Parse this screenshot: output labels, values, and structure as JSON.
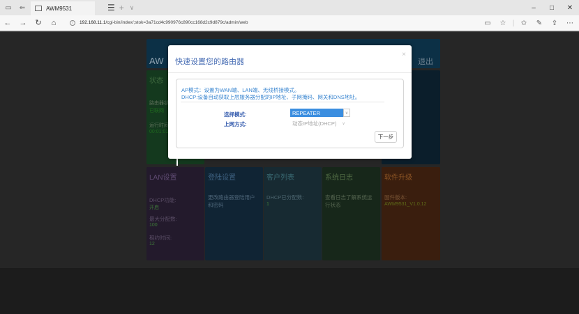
{
  "browser": {
    "tab_title": "AWM9531",
    "url_host": "192.168.11.1",
    "url_path": "/cgi-bin/index/;stok=3a71cd4c990976c890cc168d2c9d879c/admin/web",
    "new_tab": "+",
    "tab_dropdown": "∨"
  },
  "page": {
    "header": {
      "brand": "AW",
      "logout": "退出"
    },
    "status_tile": {
      "title": "状态",
      "router_status_label": "路由器状态",
      "router_status_value": "已联网",
      "uptime_label": "运行时间",
      "uptime_value": "00:01:01"
    },
    "lan_tile": {
      "title": "LAN设置",
      "dhcp_label": "DHCP功能:",
      "dhcp_value": "开启",
      "max_alloc_label": "最大分配数:",
      "max_alloc_value": "100",
      "lease_label": "租约时间:",
      "lease_value": "12"
    },
    "login_tile": {
      "title": "登陆设置",
      "text": "更改路由器登陆用户和密码"
    },
    "clients_tile": {
      "title": "客户列表",
      "text": "DHCP已分配数:",
      "value": "1"
    },
    "log_tile": {
      "title": "系统日志",
      "text": "查看日志了解系统运行状态"
    },
    "fw_tile": {
      "title": "软件升级",
      "text": "固件版本:",
      "value": "AWM9531_V1.0.12"
    }
  },
  "modal": {
    "title": "快速设置您的路由器",
    "close": "×",
    "desc_line1": "AP模式：设置为WAN端、LAN端、无线桥接模式。",
    "desc_line2": "DHCP:设备自动获取上层服务器分配的IP地址、子网掩码、网关和DNS地址。",
    "mode_label": "选择模式:",
    "mode_value": "REPEATER",
    "connection_label": "上网方式:",
    "connection_value": "动态IP地址(DHCP)",
    "next_button": "下一步"
  }
}
